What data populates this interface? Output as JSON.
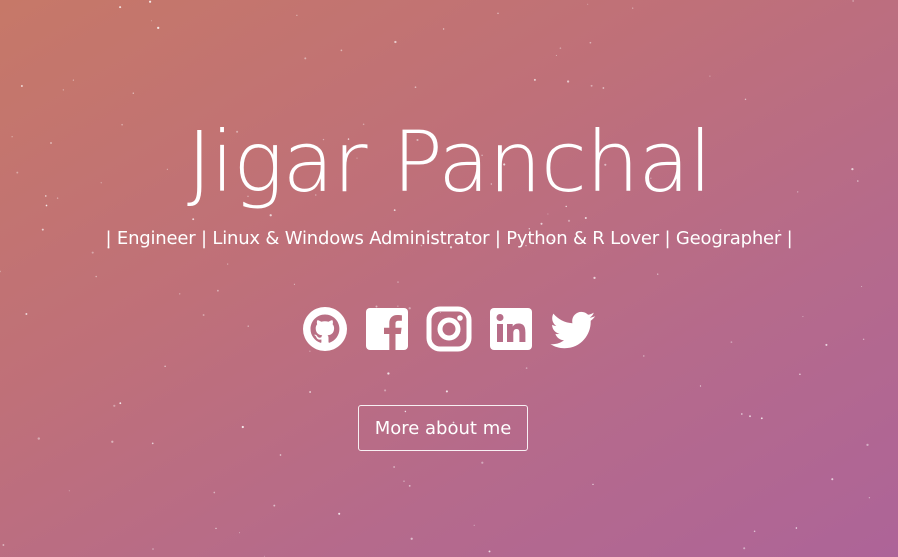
{
  "hero": {
    "name": "Jigar Panchal",
    "tagline": "| Engineer | Linux & Windows Administrator | Python & R Lover | Geographer |",
    "background_colors": [
      "#c67868",
      "#ad6498"
    ],
    "cta_label": "More about me"
  },
  "social": [
    {
      "icon": "github-icon"
    },
    {
      "icon": "facebook-icon"
    },
    {
      "icon": "instagram-icon"
    },
    {
      "icon": "linkedin-icon"
    },
    {
      "icon": "twitter-icon"
    }
  ]
}
